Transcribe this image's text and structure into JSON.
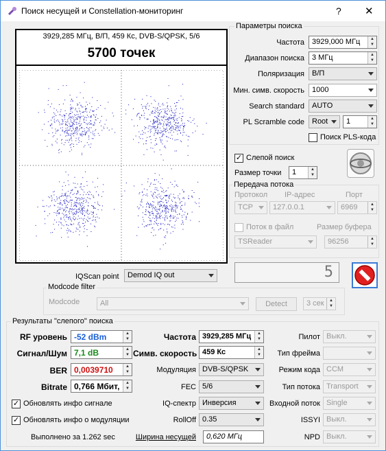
{
  "window": {
    "title": "Поиск несущей и Constellation-мониторинг",
    "help_label": "?",
    "close_label": "✕"
  },
  "constellation": {
    "header": "3929,285 МГц, В/П, 459 Кс, DVB-S/QPSK, 5/6",
    "points": "5700 точек"
  },
  "search_params": {
    "title": "Параметры поиска",
    "frequency_label": "Частота",
    "frequency_value": "3929,000 МГц",
    "range_label": "Диапазон поиска",
    "range_value": "3 МГц",
    "polarization_label": "Поляризация",
    "polarization_value": "В/П",
    "min_sr_label": "Мин. симв. скорость",
    "min_sr_value": "1000",
    "standard_label": "Search standard",
    "standard_value": "AUTO",
    "pls_label": "PL Scramble code",
    "pls_mode": "Root",
    "pls_value": "1",
    "pls_search_label": "Поиск PLS-кода"
  },
  "blind": {
    "label": "Слепой поиск",
    "point_size_label": "Размер точки",
    "point_size_value": "1"
  },
  "stream": {
    "title": "Передача потока",
    "protocol_label": "Протокол",
    "protocol_value": "TCP",
    "ip_label": "IP-адрес",
    "ip_value": "127.0.0.1",
    "port_label": "Порт",
    "port_value": "6969",
    "file_label": "Поток в файл",
    "buffer_label": "Размер буфера",
    "reader_value": "TSReader",
    "buffer_value": "96256"
  },
  "display_value": "5",
  "iqscan": {
    "label": "IQScan point",
    "value": "Demod IQ out"
  },
  "modcode": {
    "title": "Modcode filter",
    "label": "Modcode",
    "value": "All",
    "detect_label": "Detect",
    "time_value": "3 сек"
  },
  "results": {
    "title": "Результаты \"слепого\" поиска",
    "rf_label": "RF уровень",
    "rf_value": "-52 dBm",
    "snr_label": "Сигнал/Шум",
    "snr_value": "7,1 dB",
    "ber_label": "BER",
    "ber_value": "0,0039710",
    "bitrate_label": "Bitrate",
    "bitrate_value": "0,766 Мбит,",
    "freq_label": "Частота",
    "freq_value": "3929,285 МГц",
    "sr_label": "Симв. скорость",
    "sr_value": "459 Кс",
    "mod_label": "Модуляция",
    "mod_value": "DVB-S/QPSK",
    "fec_label": "FEC",
    "fec_value": "5/6",
    "iq_label": "IQ-спектр",
    "iq_value": "Инверсия",
    "rolloff_label": "RollOff",
    "rolloff_value": "0.35",
    "bw_label": "Ширина несущей",
    "bw_value": "0,620 МГц",
    "pilot_label": "Пилот",
    "pilot_value": "Выкл.",
    "frame_label": "Тип фрейма",
    "frame_value": "",
    "code_label": "Режим кода",
    "code_value": "CCM",
    "stream_type_label": "Тип потока",
    "stream_type_value": "Transport",
    "input_label": "Входной поток",
    "input_value": "Single",
    "issyi_label": "ISSYI",
    "issyi_value": "Выкл.",
    "npd_label": "NPD",
    "npd_value": "Выкл.",
    "update_signal_label": "Обновлять инфо сигнале",
    "update_mod_label": "Обновлять инфо о модуляции",
    "elapsed": "Выполнено за 1.262 sec"
  },
  "colors": {
    "rf": "#1a5fd6",
    "snr": "#1a8a1a",
    "ber": "#d01010",
    "dots": "#1010c0"
  }
}
